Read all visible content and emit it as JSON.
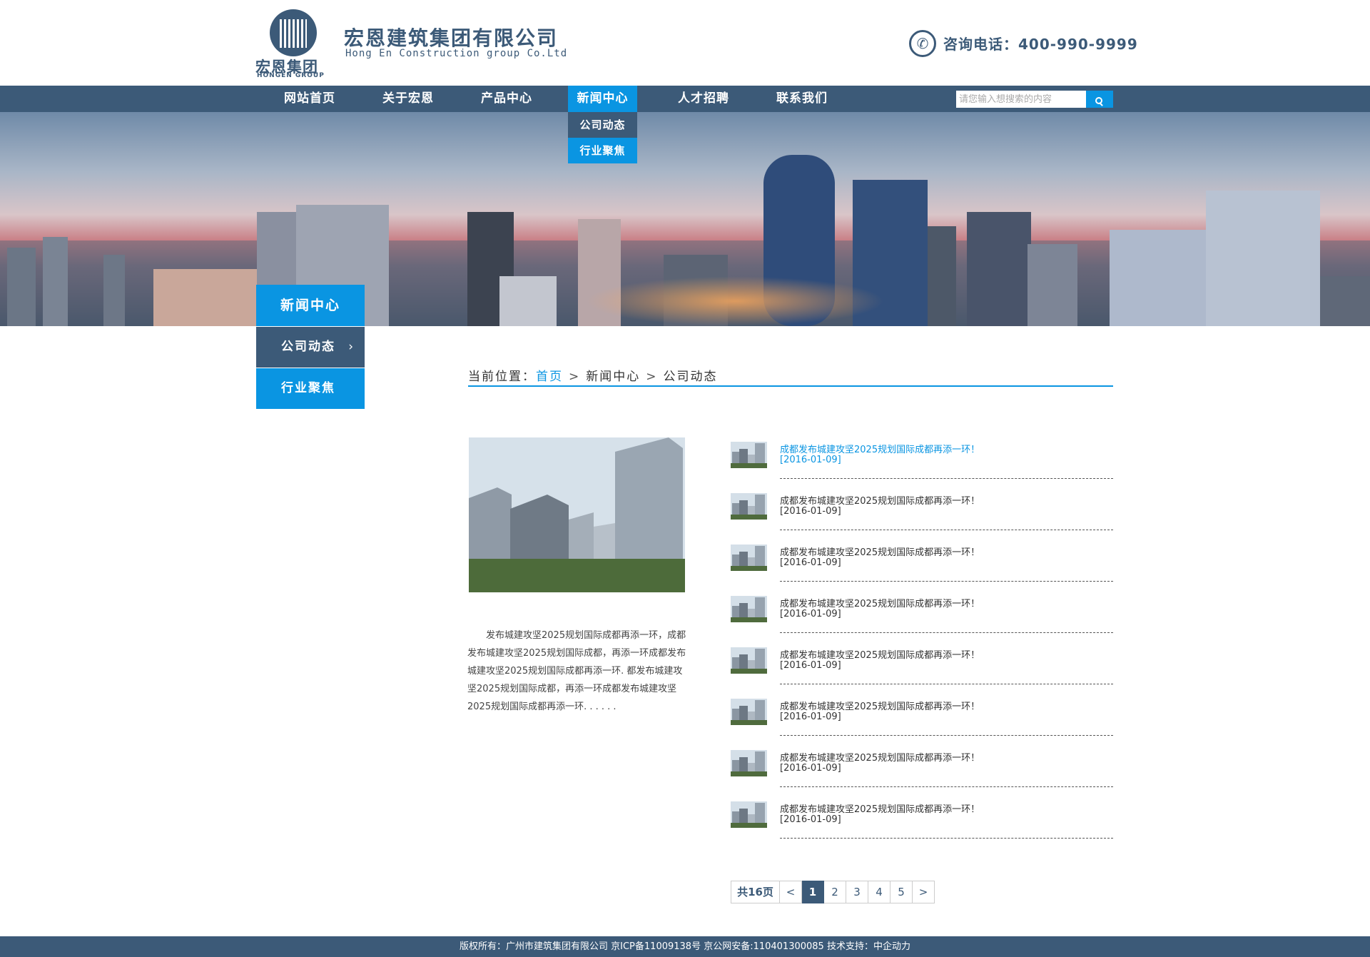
{
  "header": {
    "logo_cn": "宏恩集团",
    "logo_en": "HONGEN GROUP",
    "company_cn": "宏恩建筑集团有限公司",
    "company_en": "Hong En Construction group Co.Ltd",
    "phone_label": "咨询电话：400-990-9999"
  },
  "nav": {
    "items": [
      {
        "label": "网站首页"
      },
      {
        "label": "关于宏恩"
      },
      {
        "label": "产品中心"
      },
      {
        "label": "新闻中心"
      },
      {
        "label": "人才招聘"
      },
      {
        "label": "联系我们"
      }
    ],
    "active_index": 3,
    "dropdown": [
      "公司动态",
      "行业聚焦"
    ],
    "search_placeholder": "请您输入想搜索的内容"
  },
  "sidebar": {
    "title": "新闻中心",
    "items": [
      {
        "label": "公司动态",
        "active": true
      },
      {
        "label": "行业聚焦",
        "active": false
      }
    ]
  },
  "breadcrumb": {
    "prefix": "当前位置：",
    "home": "首页",
    "level1": "新闻中心",
    "level2": "公司动态",
    "separator": ">"
  },
  "featured": {
    "text": "发布城建攻坚2025规划国际成都再添一环，成都发布城建攻坚2025规划国际成都，再添一环成都发布城建攻坚2025规划国际成都再添一环. 都发布城建攻坚2025规划国际成都，再添一环成都发布城建攻坚2025规划国际成都再添一环. . . . . ."
  },
  "news": [
    {
      "title": "成都发布城建攻坚2025规划国际成都再添一环！",
      "date": "[2016-01-09]",
      "highlight": true
    },
    {
      "title": "成都发布城建攻坚2025规划国际成都再添一环！",
      "date": "[2016-01-09]",
      "highlight": false
    },
    {
      "title": "成都发布城建攻坚2025规划国际成都再添一环！",
      "date": "[2016-01-09]",
      "highlight": false
    },
    {
      "title": "成都发布城建攻坚2025规划国际成都再添一环！",
      "date": "[2016-01-09]",
      "highlight": false
    },
    {
      "title": "成都发布城建攻坚2025规划国际成都再添一环！",
      "date": "[2016-01-09]",
      "highlight": false
    },
    {
      "title": "成都发布城建攻坚2025规划国际成都再添一环！",
      "date": "[2016-01-09]",
      "highlight": false
    },
    {
      "title": "成都发布城建攻坚2025规划国际成都再添一环！",
      "date": "[2016-01-09]",
      "highlight": false
    },
    {
      "title": "成都发布城建攻坚2025规划国际成都再添一环！",
      "date": "[2016-01-09]",
      "highlight": false
    }
  ],
  "pagination": {
    "total": "共16页",
    "prev": "<",
    "pages": [
      "1",
      "2",
      "3",
      "4",
      "5"
    ],
    "current": "1",
    "next": ">"
  },
  "footer": {
    "text": "版权所有：广州市建筑集团有限公司 京ICP备11009138号 京公网安备:110401300085 技术支持：中企动力"
  },
  "colors": {
    "nav_bg": "#3c5a78",
    "accent": "#0a95e2",
    "text": "#333333"
  },
  "icons": [
    "phone-icon",
    "search-icon",
    "chevron-right-icon",
    "chevron-left-icon"
  ]
}
